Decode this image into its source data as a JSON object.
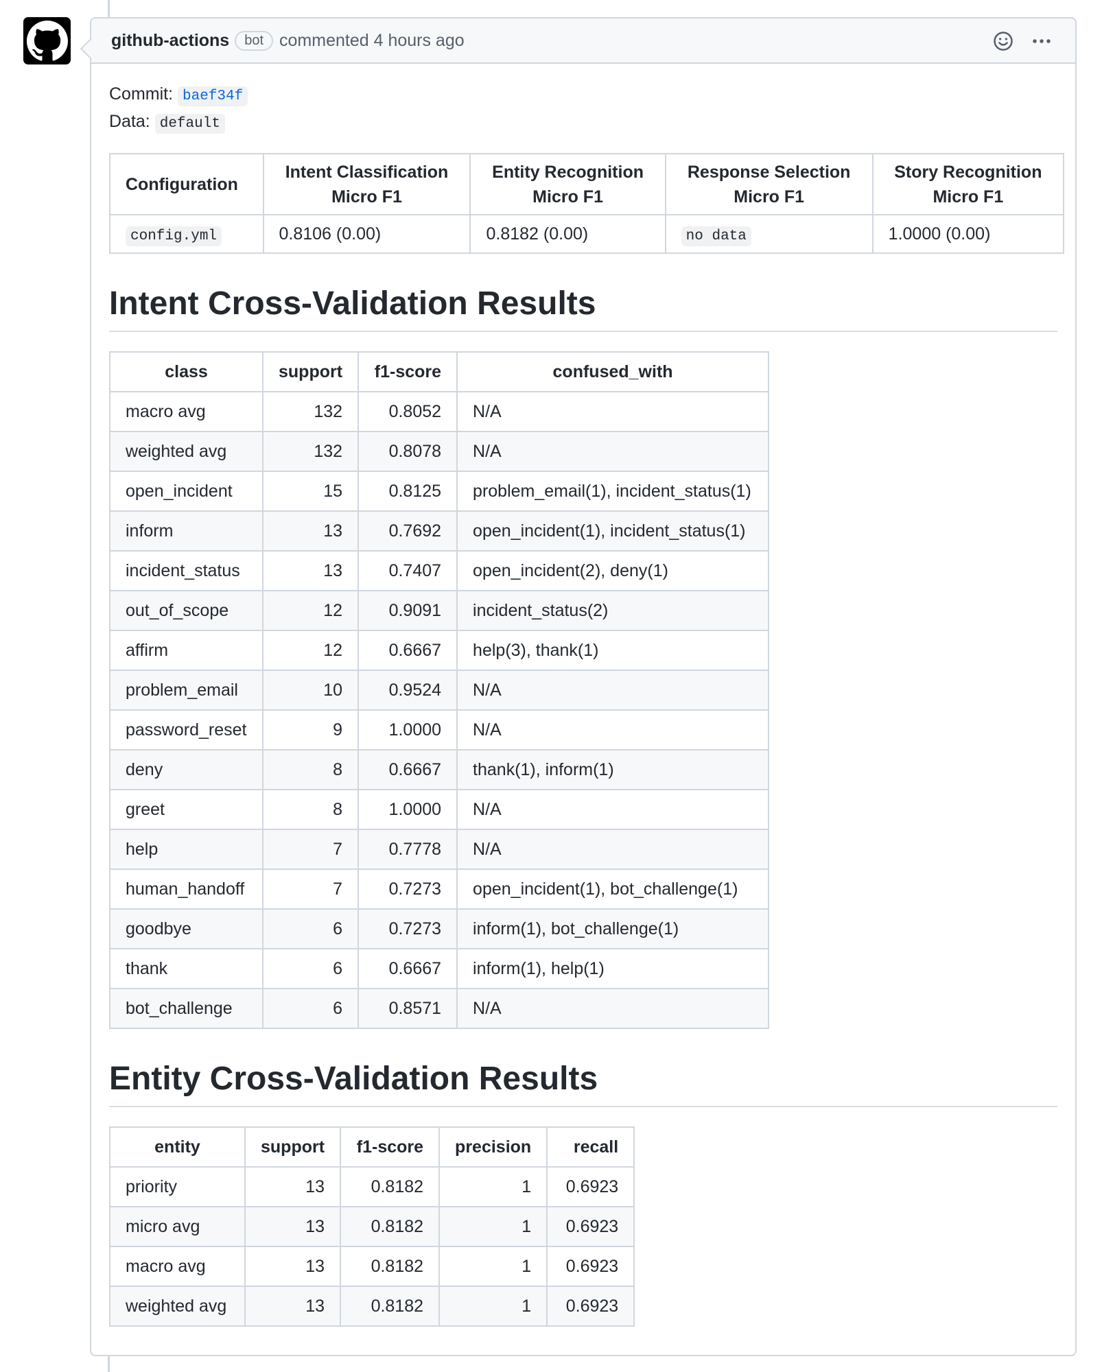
{
  "comment": {
    "author": "github-actions",
    "badge": "bot",
    "meta": "commented 4 hours ago"
  },
  "commit": {
    "label": "Commit:",
    "hash": "baef34f"
  },
  "data_line": {
    "label": "Data:",
    "value": "default"
  },
  "config_table": {
    "headers": [
      [
        "Configuration"
      ],
      [
        "Intent Classification",
        "Micro F1"
      ],
      [
        "Entity Recognition",
        "Micro F1"
      ],
      [
        "Response Selection",
        "Micro F1"
      ],
      [
        "Story Recognition",
        "Micro F1"
      ]
    ],
    "row": [
      "config.yml",
      "0.8106 (0.00)",
      "0.8182 (0.00)",
      "no data",
      "1.0000 (0.00)"
    ]
  },
  "intent_section": {
    "title": "Intent Cross-Validation Results",
    "headers": [
      "class",
      "support",
      "f1-score",
      "confused_with"
    ],
    "rows": [
      [
        "macro avg",
        "132",
        "0.8052",
        "N/A"
      ],
      [
        "weighted avg",
        "132",
        "0.8078",
        "N/A"
      ],
      [
        "open_incident",
        "15",
        "0.8125",
        "problem_email(1), incident_status(1)"
      ],
      [
        "inform",
        "13",
        "0.7692",
        "open_incident(1), incident_status(1)"
      ],
      [
        "incident_status",
        "13",
        "0.7407",
        "open_incident(2), deny(1)"
      ],
      [
        "out_of_scope",
        "12",
        "0.9091",
        "incident_status(2)"
      ],
      [
        "affirm",
        "12",
        "0.6667",
        "help(3), thank(1)"
      ],
      [
        "problem_email",
        "10",
        "0.9524",
        "N/A"
      ],
      [
        "password_reset",
        "9",
        "1.0000",
        "N/A"
      ],
      [
        "deny",
        "8",
        "0.6667",
        "thank(1), inform(1)"
      ],
      [
        "greet",
        "8",
        "1.0000",
        "N/A"
      ],
      [
        "help",
        "7",
        "0.7778",
        "N/A"
      ],
      [
        "human_handoff",
        "7",
        "0.7273",
        "open_incident(1), bot_challenge(1)"
      ],
      [
        "goodbye",
        "6",
        "0.7273",
        "inform(1), bot_challenge(1)"
      ],
      [
        "thank",
        "6",
        "0.6667",
        "inform(1), help(1)"
      ],
      [
        "bot_challenge",
        "6",
        "0.8571",
        "N/A"
      ]
    ]
  },
  "entity_section": {
    "title": "Entity Cross-Validation Results",
    "headers": [
      "entity",
      "support",
      "f1-score",
      "precision",
      "recall"
    ],
    "rows": [
      [
        "priority",
        "13",
        "0.8182",
        "1",
        "0.6923"
      ],
      [
        "micro avg",
        "13",
        "0.8182",
        "1",
        "0.6923"
      ],
      [
        "macro avg",
        "13",
        "0.8182",
        "1",
        "0.6923"
      ],
      [
        "weighted avg",
        "13",
        "0.8182",
        "1",
        "0.6923"
      ]
    ]
  },
  "icons": {
    "avatar": "github-octocat-icon",
    "reaction": "smiley-icon",
    "menu": "kebab-horizontal-icon"
  },
  "colors": {
    "link": "#0969da",
    "border": "#d0d7de",
    "header_bg": "#f6f8fa",
    "text": "#24292f",
    "muted": "#57606a"
  }
}
